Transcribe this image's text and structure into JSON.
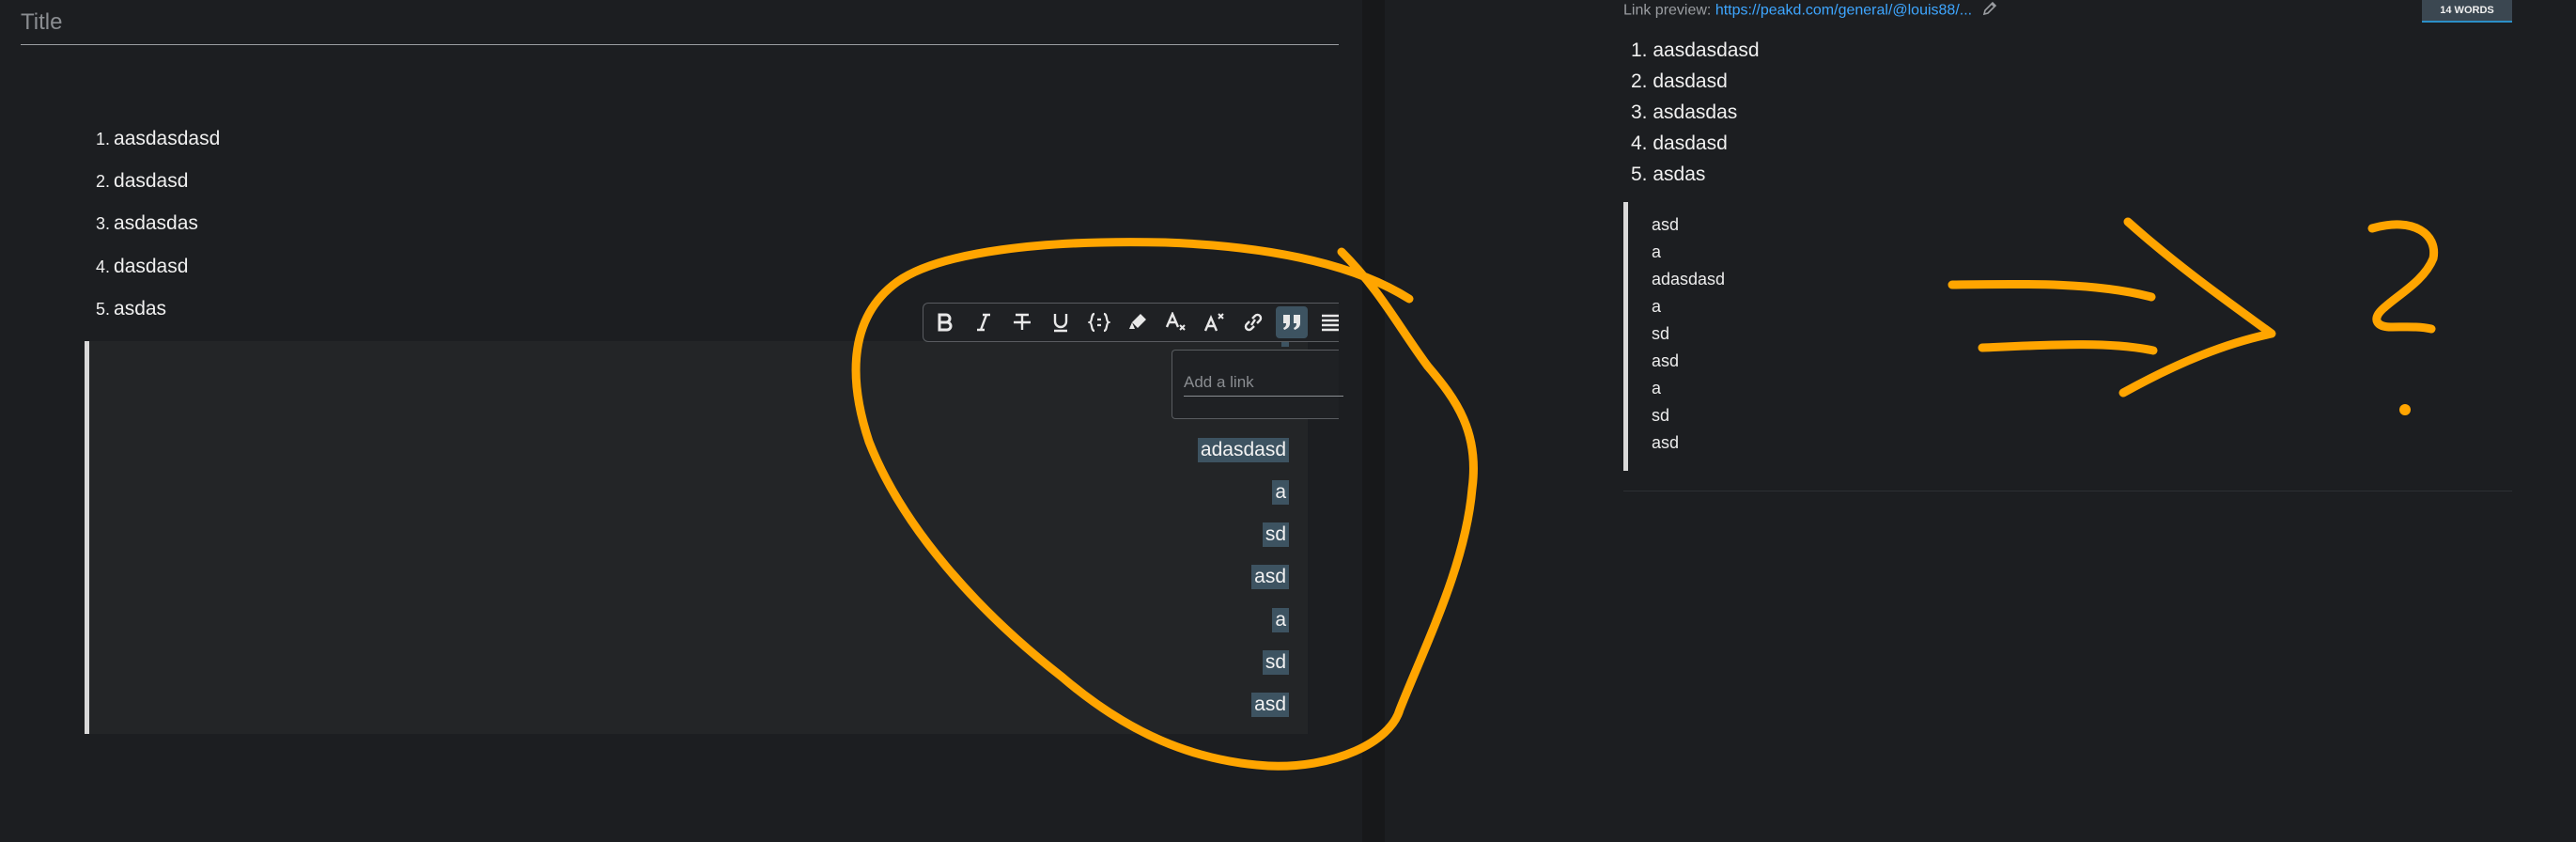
{
  "editor": {
    "title_placeholder": "Title",
    "list": [
      {
        "num": "1.",
        "text": "aasdasdasd"
      },
      {
        "num": "2.",
        "text": "dasdasd"
      },
      {
        "num": "3.",
        "text": "asdasdas"
      },
      {
        "num": "4.",
        "text": "dasdasd"
      },
      {
        "num": "5.",
        "text": "asdas"
      }
    ],
    "quote_selected_lines": [
      "adasdasd",
      "a",
      "sd",
      "asd",
      "a",
      "sd",
      "asd"
    ],
    "toolbar": [
      "bold-icon",
      "italic-icon",
      "strikethrough-icon",
      "underline-icon",
      "code-block-icon",
      "highlight-icon",
      "subscript-icon",
      "superscript-icon",
      "link-icon",
      "blockquote-icon",
      "align-icon"
    ],
    "link_placeholder": "Add a link"
  },
  "preview": {
    "link_label": "Link preview:",
    "link_url": "https://peakd.com/general/@louis88/...",
    "word_count": "14 WORDS",
    "list": [
      {
        "num": "1.",
        "text": "aasdasdasd"
      },
      {
        "num": "2.",
        "text": "dasdasd"
      },
      {
        "num": "3.",
        "text": "asdasdas"
      },
      {
        "num": "4.",
        "text": "dasdasd"
      },
      {
        "num": "5.",
        "text": "asdas"
      }
    ],
    "quote_lines": [
      "asd",
      "a",
      "adasdasd",
      "a",
      "sd",
      "asd",
      "a",
      "sd",
      "asd"
    ]
  },
  "colors": {
    "annotation": "#ffa500",
    "selection": "#3d5361",
    "link": "#3ea6ff"
  }
}
